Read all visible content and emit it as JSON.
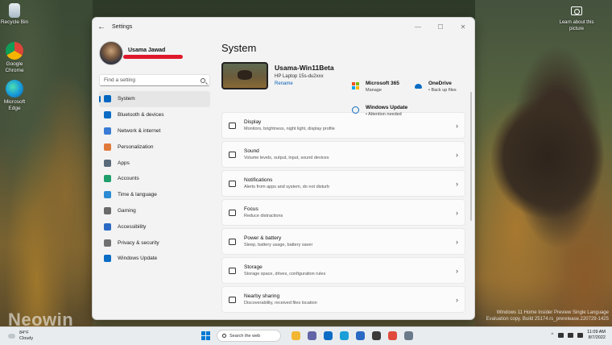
{
  "desktop": {
    "icons": [
      {
        "label": "Recycle Bin"
      },
      {
        "label": "Google Chrome"
      },
      {
        "label": "Microsoft Edge"
      }
    ],
    "camera_label": "Learn about this picture",
    "watermark": "Neowin",
    "eval_line1": "Windows 11 Home Insider Preview Single Language",
    "eval_line2": "Evaluation copy. Build 25174.rs_prerelease.220729-1425"
  },
  "window": {
    "title": "Settings",
    "back": "←",
    "minimize": "—",
    "maximize": "☐",
    "close": "✕"
  },
  "profile": {
    "name": "Usama Jawad"
  },
  "search": {
    "placeholder": "Find a setting"
  },
  "nav": {
    "items": [
      {
        "label": "System",
        "color": "#0067c0"
      },
      {
        "label": "Bluetooth & devices",
        "color": "#0a6cc4"
      },
      {
        "label": "Network & internet",
        "color": "#3a7bd5"
      },
      {
        "label": "Personalization",
        "color": "#e07a3a"
      },
      {
        "label": "Apps",
        "color": "#5a6a7a"
      },
      {
        "label": "Accounts",
        "color": "#1e9e6a"
      },
      {
        "label": "Time & language",
        "color": "#2a8ad4"
      },
      {
        "label": "Gaming",
        "color": "#6a6a6a"
      },
      {
        "label": "Accessibility",
        "color": "#2a6ac4"
      },
      {
        "label": "Privacy & security",
        "color": "#707070"
      },
      {
        "label": "Windows Update",
        "color": "#0a6cc4"
      }
    ]
  },
  "main": {
    "title": "System",
    "device": {
      "name": "Usama-Win11Beta",
      "model": "HP Laptop 15s-du2xxx",
      "rename": "Rename"
    },
    "quick": {
      "ms365_title": "Microsoft 365",
      "ms365_sub": "Manage",
      "onedrive_title": "OneDrive",
      "onedrive_sub": "• Back up files",
      "update_title": "Windows Update",
      "update_sub": "• Attention needed"
    },
    "rows": [
      {
        "title": "Display",
        "subtitle": "Monitors, brightness, night light, display profile"
      },
      {
        "title": "Sound",
        "subtitle": "Volume levels, output, input, sound devices"
      },
      {
        "title": "Notifications",
        "subtitle": "Alerts from apps and system, do not disturb"
      },
      {
        "title": "Focus",
        "subtitle": "Reduce distractions"
      },
      {
        "title": "Power & battery",
        "subtitle": "Sleep, battery usage, battery saver"
      },
      {
        "title": "Storage",
        "subtitle": "Storage space, drives, configuration rules"
      },
      {
        "title": "Nearby sharing",
        "subtitle": "Discoverability, received files location"
      }
    ],
    "chevron": "›"
  },
  "taskbar": {
    "weather_temp": "84°F",
    "weather_desc": "Cloudy",
    "search_label": "Search the web",
    "apps": [
      {
        "name": "file-explorer-icon",
        "color": "#f2b632"
      },
      {
        "name": "teams-chat-icon",
        "color": "#6264a7"
      },
      {
        "name": "mail-icon",
        "color": "#0a6cc4"
      },
      {
        "name": "edge-icon",
        "color": "#1a9ed8"
      },
      {
        "name": "store-icon",
        "color": "#2a6ac4"
      },
      {
        "name": "xbox-icon",
        "color": "#3a3a3a"
      },
      {
        "name": "chrome-icon",
        "color": "#e04a3a"
      },
      {
        "name": "settings-icon",
        "color": "#6a7a8a"
      }
    ],
    "caret": "^",
    "time": "11:09 AM",
    "date": "8/7/2022"
  }
}
